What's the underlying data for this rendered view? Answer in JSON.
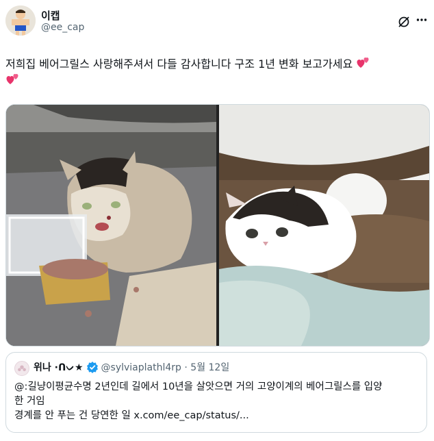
{
  "author": {
    "name": "이캡",
    "handle": "@ee_cap",
    "avatar_icon": "cartoon-person-avatar"
  },
  "tweet": {
    "text": "저희집 베어그릴스 사랑해주셔서 다들 감사합니다 구조 1년 변화 보고가세요",
    "emoji": [
      "two-hearts-icon",
      "two-hearts-icon"
    ]
  },
  "media": [
    {
      "icon": "stray-cat-photo-before-rescue"
    },
    {
      "icon": "cat-photo-after-one-year"
    }
  ],
  "quote": {
    "name": "위나 ·ᑎᨆ★",
    "handle": "@sylviaplathl4rp",
    "separator": "·",
    "date": "5월 12일",
    "lines": [
      "@:길냥이평균수명 2년인데 길에서 10년을 살앗으면 거의 고양이계의 베어그릴스를 입양",
      "한 거임",
      "경계를 안 푸는 건 당연한 일 x.com/ee_cap/status/..."
    ]
  },
  "colors": {
    "text": "#0f1419",
    "secondary": "#536471",
    "border": "#cfd9de",
    "verified": "#1d9bf0",
    "heart": "#e8346b"
  }
}
